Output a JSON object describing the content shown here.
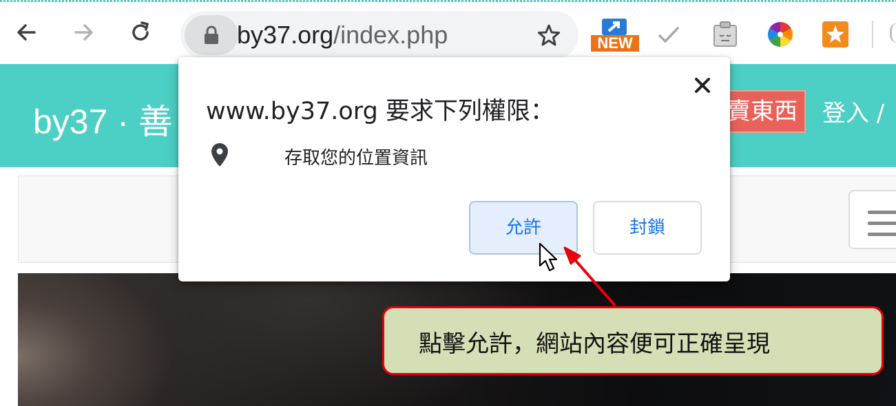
{
  "browser": {
    "url_host": "by37.org",
    "url_path": "/index.php",
    "extensions": [
      {
        "name": "new-extension",
        "badge": "NEW"
      },
      {
        "name": "check-extension"
      },
      {
        "name": "clipboard-extension"
      },
      {
        "name": "color-wheel-extension"
      },
      {
        "name": "star-extension"
      }
    ]
  },
  "site": {
    "brand": "by37 · 善",
    "sell_button": "賣東西",
    "login_link": "登入 /"
  },
  "permission_popup": {
    "title": "www.by37.org 要求下列權限：",
    "permission_text": "存取您的位置資訊",
    "allow_label": "允許",
    "block_label": "封鎖",
    "close_symbol": "×"
  },
  "annotation": {
    "callout_text": "點擊允許，網站內容便可正確呈現",
    "color": "#e8000a",
    "callout_bg": "#d5dfb5"
  },
  "colors": {
    "header_teal": "#4ccfc4",
    "sell_red": "#e9625a",
    "link_blue": "#1a73e8"
  }
}
